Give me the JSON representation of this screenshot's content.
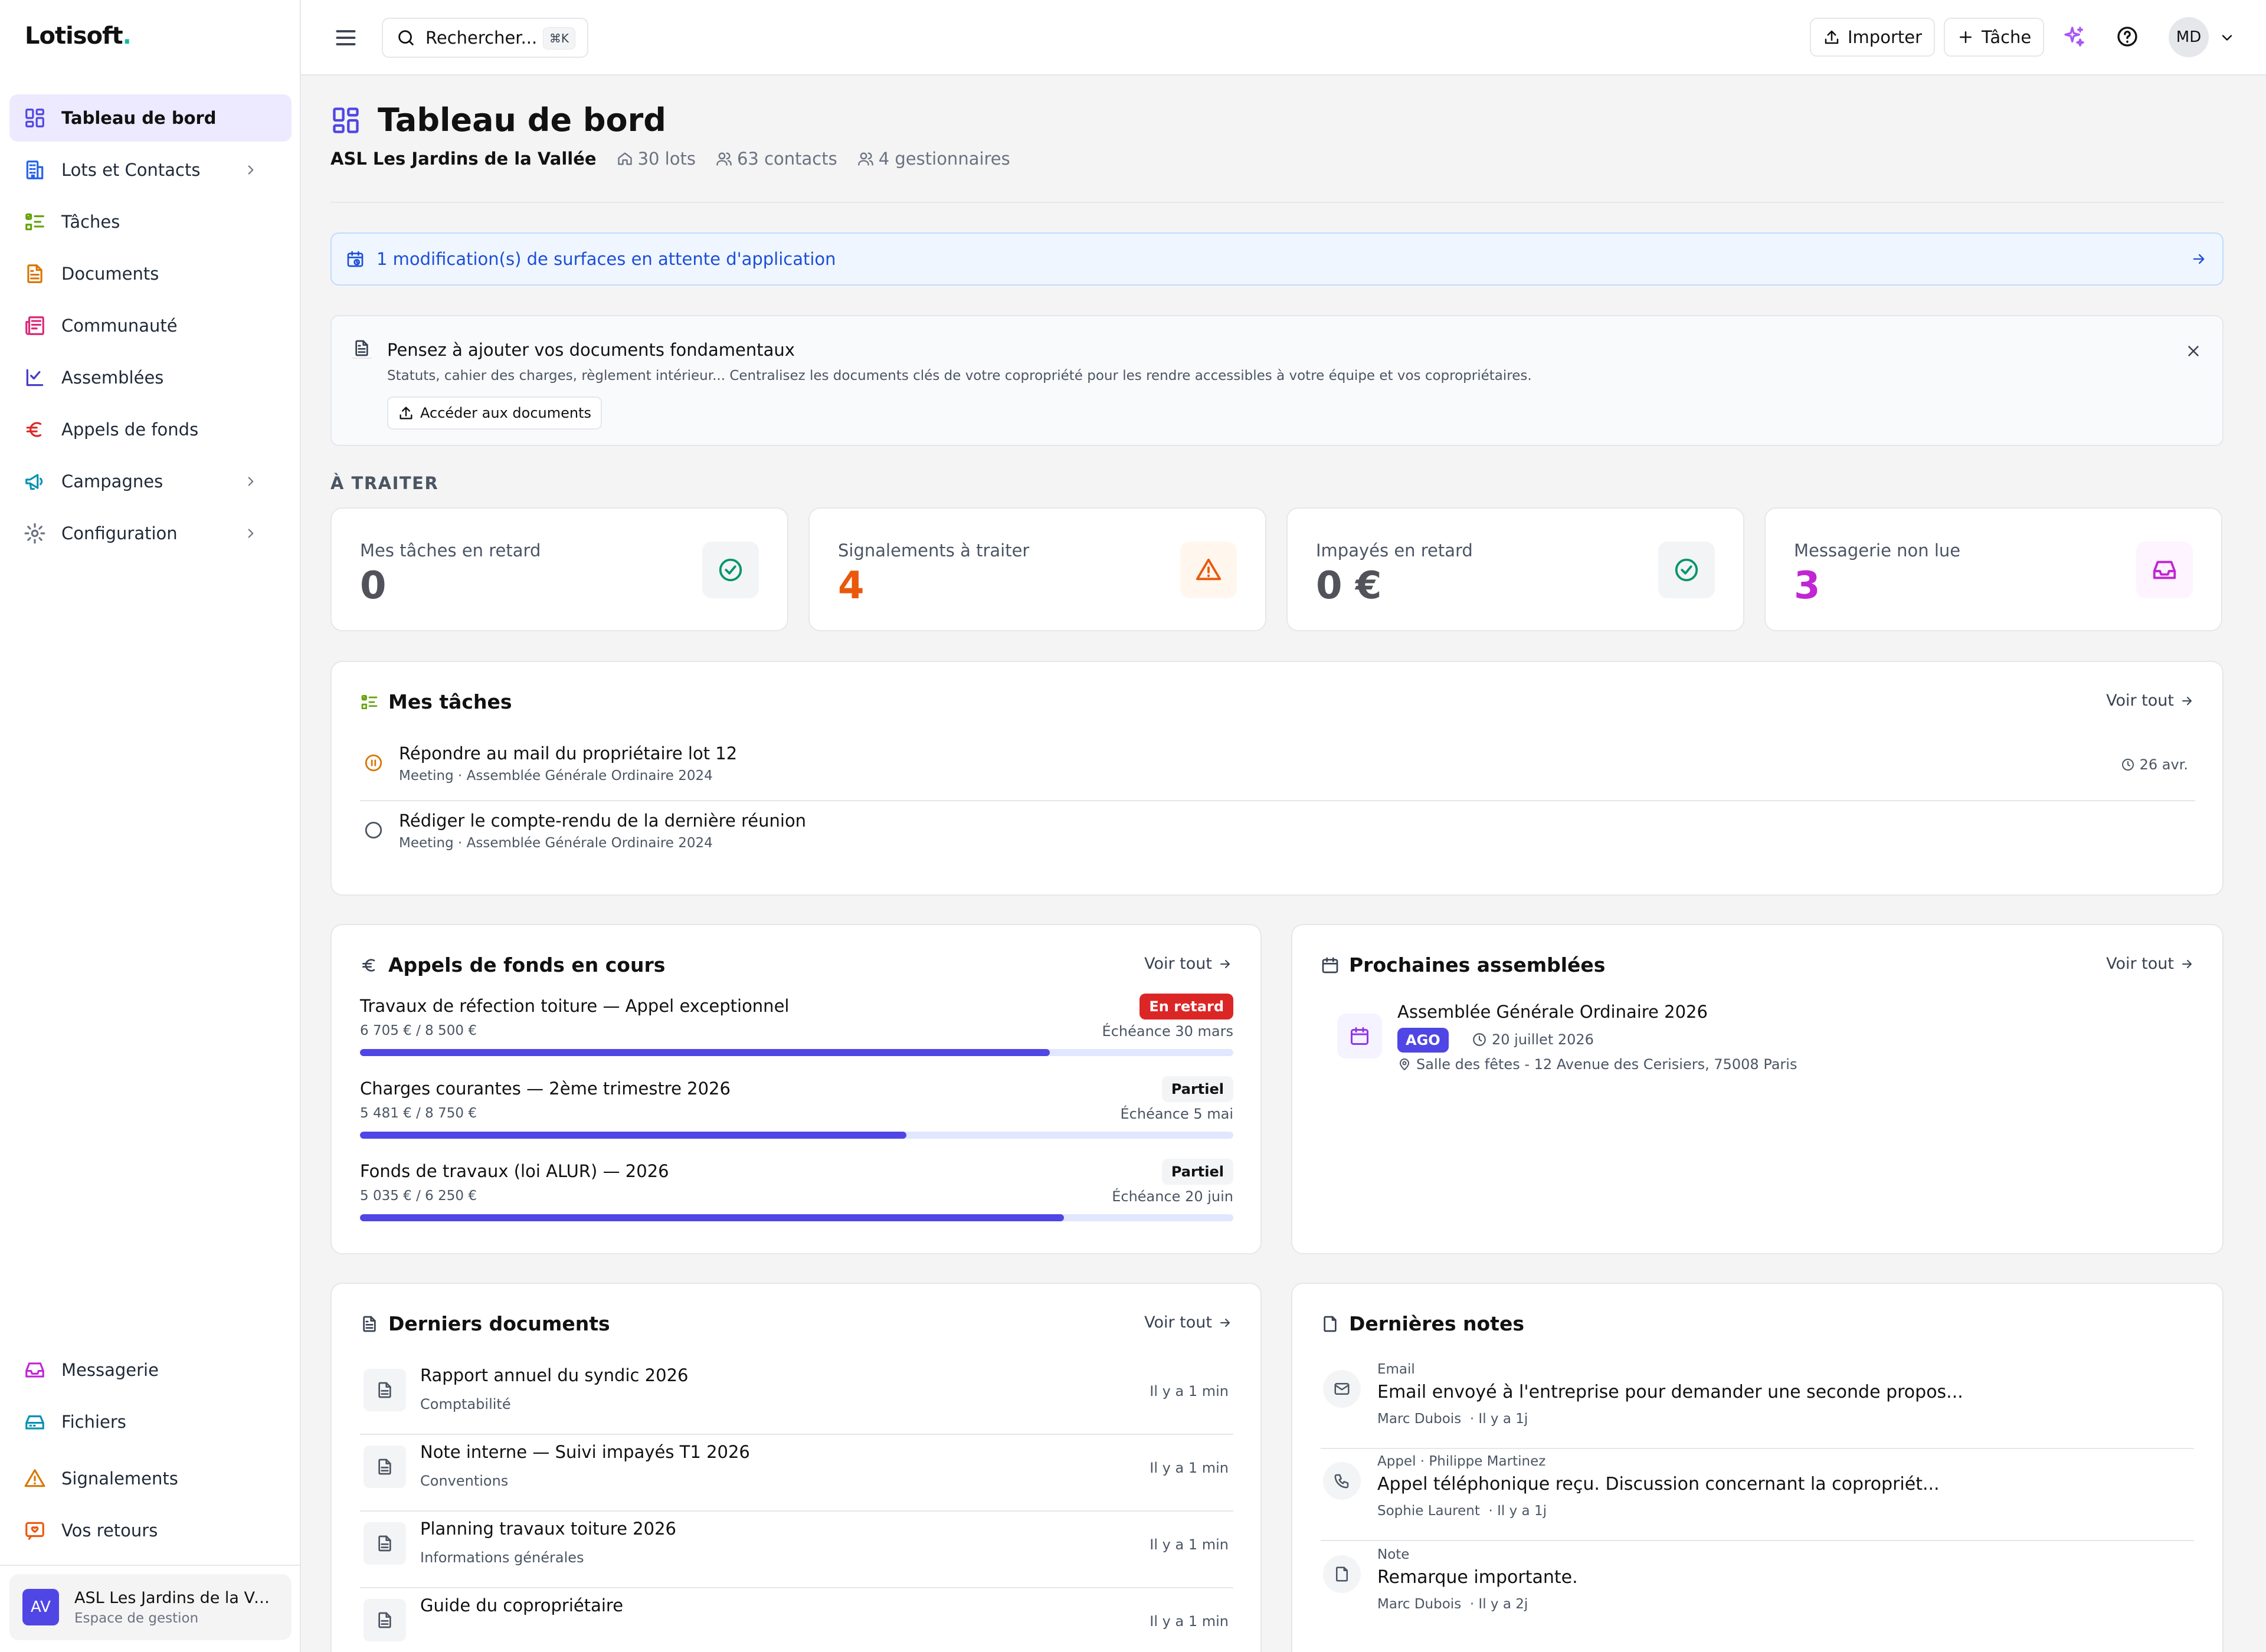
{
  "app": {
    "logo": "Lotisoft",
    "logo_dot": "."
  },
  "sidebar": {
    "items": [
      {
        "label": "Tableau de bord"
      },
      {
        "label": "Lots et Contacts"
      },
      {
        "label": "Tâches"
      },
      {
        "label": "Documents"
      },
      {
        "label": "Communauté"
      },
      {
        "label": "Assemblées"
      },
      {
        "label": "Appels de fonds"
      },
      {
        "label": "Campagnes"
      },
      {
        "label": "Configuration"
      }
    ],
    "bottom_items": [
      {
        "label": "Messagerie"
      },
      {
        "label": "Fichiers"
      },
      {
        "label": "Signalements"
      },
      {
        "label": "Vos retours"
      }
    ],
    "workspace": {
      "initials": "AV",
      "name": "ASL Les Jardins de la Vallée",
      "subtitle": "Espace de gestion"
    }
  },
  "topbar": {
    "search_placeholder": "Rechercher...",
    "search_shortcut": "⌘K",
    "import_label": "Importer",
    "task_label": "Tâche",
    "user_initials": "MD"
  },
  "page": {
    "title": "Tableau de bord",
    "org": "ASL Les Jardins de la Vallée",
    "lots": "30 lots",
    "contacts": "63 contacts",
    "managers": "4 gestionnaires"
  },
  "alert": {
    "text": "1 modification(s) de surfaces en attente d'application"
  },
  "reminder": {
    "title": "Pensez à ajouter vos documents fondamentaux",
    "desc": "Statuts, cahier des charges, règlement intérieur... Centralisez les documents clés de votre copropriété pour les rendre accessibles à votre équipe et vos copropriétaires.",
    "button": "Accéder aux documents"
  },
  "section_traiter": "À TRAITER",
  "stats": [
    {
      "label": "Mes tâches en retard",
      "value": "0",
      "color": "#52525b",
      "icon": "check-circle-icon"
    },
    {
      "label": "Signalements à traiter",
      "value": "4",
      "color": "#ea580c",
      "icon": "warning-icon"
    },
    {
      "label": "Impayés en retard",
      "value": "0 €",
      "color": "#52525b",
      "icon": "check-circle-icon"
    },
    {
      "label": "Messagerie non lue",
      "value": "3",
      "color": "#c026d3",
      "icon": "inbox-icon"
    }
  ],
  "tasks": {
    "title": "Mes tâches",
    "view_all": "Voir tout",
    "items": [
      {
        "title": "Répondre au mail du propriétaire lot 12",
        "sub": "Meeting · Assemblée Générale Ordinaire 2024",
        "date": "26 avr."
      },
      {
        "title": "Rédiger le compte-rendu de la dernière réunion",
        "sub": "Meeting · Assemblée Générale Ordinaire 2024",
        "date": ""
      }
    ]
  },
  "funds": {
    "title": "Appels de fonds en cours",
    "view_all": "Voir tout",
    "items": [
      {
        "title": "Travaux de réfection toiture — Appel exceptionnel",
        "amount": "6 705 € / 8 500 €",
        "due": "Échéance 30 mars",
        "badge": "En retard",
        "progress": 0.79
      },
      {
        "title": "Charges courantes — 2ème trimestre 2026",
        "amount": "5 481 € / 8 750 €",
        "due": "Échéance 5 mai",
        "badge": "Partiel",
        "progress": 0.626
      },
      {
        "title": "Fonds de travaux (loi ALUR) — 2026",
        "amount": "5 035 € / 6 250 €",
        "due": "Échéance 20 juin",
        "badge": "Partiel",
        "progress": 0.806
      }
    ]
  },
  "assemblies": {
    "title": "Prochaines assemblées",
    "view_all": "Voir tout",
    "items": [
      {
        "title": "Assemblée Générale Ordinaire 2026",
        "badge": "AGO",
        "date": "20 juillet 2026",
        "place": "Salle des fêtes - 12 Avenue des Cerisiers, 75008 Paris"
      }
    ]
  },
  "documents": {
    "title": "Derniers documents",
    "view_all": "Voir tout",
    "items": [
      {
        "title": "Rapport annuel du syndic 2026",
        "cat": "Comptabilité",
        "time": "Il y a 1 min"
      },
      {
        "title": "Note interne — Suivi impayés T1 2026",
        "cat": "Conventions",
        "time": "Il y a 1 min"
      },
      {
        "title": "Planning travaux toiture 2026",
        "cat": "Informations générales",
        "time": "Il y a 1 min"
      },
      {
        "title": "Guide du copropriétaire",
        "cat": "",
        "time": "Il y a 1 min"
      }
    ]
  },
  "notes": {
    "title": "Dernières notes",
    "items": [
      {
        "type": "Email",
        "text": "Email envoyé à l'entreprise pour demander une seconde propos...",
        "author": "Marc Dubois",
        "time": "· Il y a 1j"
      },
      {
        "type": "Appel  · Philippe Martinez",
        "text": "Appel téléphonique reçu. Discussion concernant la copropriét...",
        "author": "Sophie Laurent",
        "time": "· Il y a 1j"
      },
      {
        "type": "Note",
        "text": "Remarque importante.",
        "author": "Marc Dubois",
        "time": "· Il y a 2j"
      }
    ]
  },
  "colors": {
    "accent": "#4f46e5",
    "danger": "#dc2626",
    "warning": "#ea580c",
    "success": "#059669",
    "magenta": "#c026d3"
  }
}
